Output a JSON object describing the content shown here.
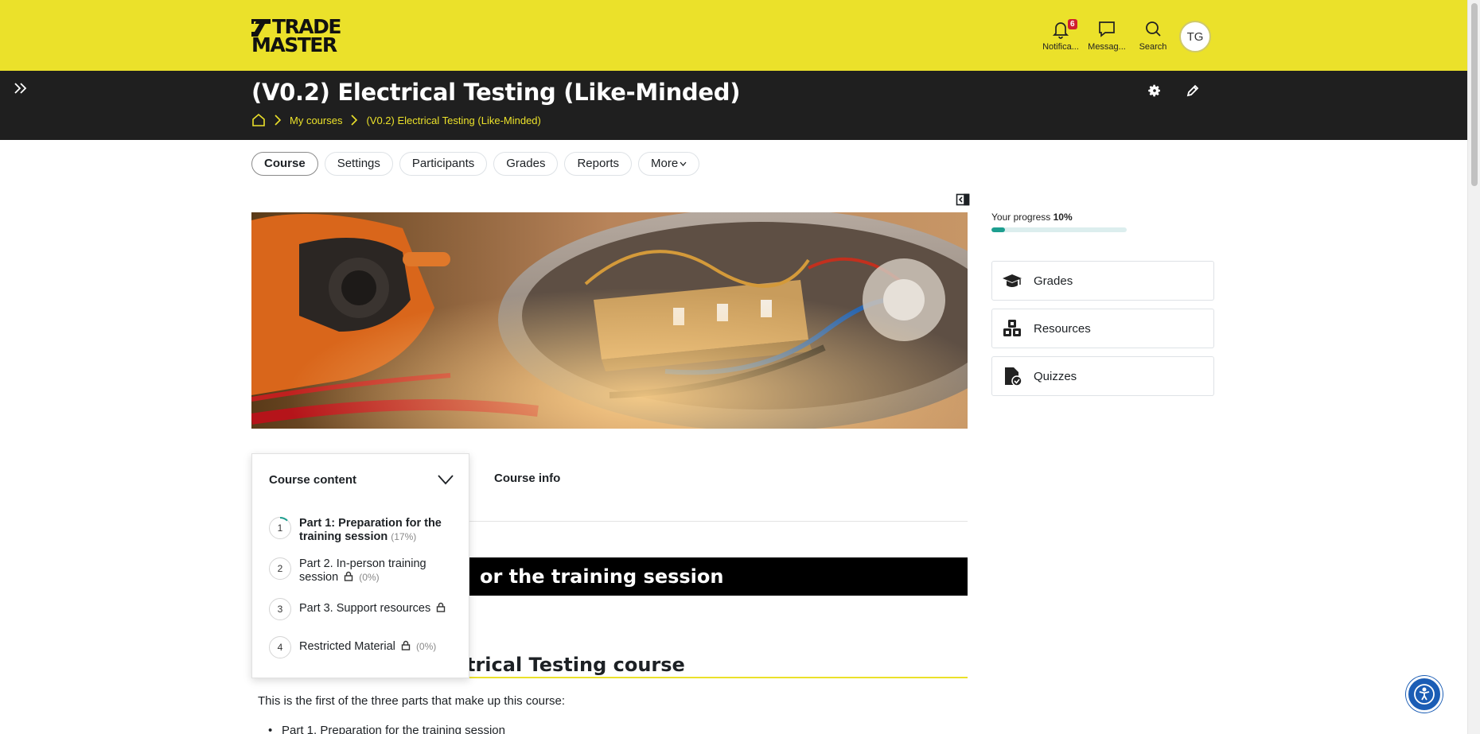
{
  "brand": {
    "line1": "TRADE",
    "line2": "MASTER",
    "accent": "#ebe12a"
  },
  "header": {
    "notifications": {
      "label": "Notifica...",
      "count": "6",
      "icon": "bell-icon"
    },
    "messages": {
      "label": "Messag...",
      "icon": "chat-icon"
    },
    "search": {
      "label": "Search",
      "icon": "search-icon"
    },
    "avatar_initials": "TG"
  },
  "course": {
    "title": "(V0.2) Electrical Testing (Like-Minded)",
    "breadcrumb": [
      "My courses",
      "(V0.2) Electrical Testing (Like-Minded)"
    ]
  },
  "tabs": [
    {
      "label": "Course",
      "active": true
    },
    {
      "label": "Settings"
    },
    {
      "label": "Participants"
    },
    {
      "label": "Grades"
    },
    {
      "label": "Reports"
    },
    {
      "label": "More"
    }
  ],
  "progress": {
    "label": "Your progress",
    "value": "10%",
    "fraction": 0.1,
    "color": "#1d9e8f"
  },
  "quicklinks": [
    {
      "label": "Grades",
      "icon": "graduation-cap-icon"
    },
    {
      "label": "Resources",
      "icon": "cubes-icon"
    },
    {
      "label": "Quizzes",
      "icon": "quiz-file-icon"
    }
  ],
  "course_content": {
    "title": "Course content",
    "items": [
      {
        "num": "1",
        "label": "Part 1: Preparation for the training session",
        "pct": "(17%)",
        "locked": false,
        "current": true
      },
      {
        "num": "2",
        "label": "Part 2. In-person training session",
        "pct": "(0%)",
        "locked": true
      },
      {
        "num": "3",
        "label": "Part 3. Support resources",
        "pct": "",
        "locked": true
      },
      {
        "num": "4",
        "label": "Restricted Material",
        "pct": "(0%)",
        "locked": true
      }
    ]
  },
  "content": {
    "course_info_tab": "Course info",
    "section_heading": "or the training session",
    "subheading": "trical Testing course",
    "intro": "This is the first of the three parts that make up this course:",
    "bullet1": "Part 1. Preparation for the training session"
  }
}
